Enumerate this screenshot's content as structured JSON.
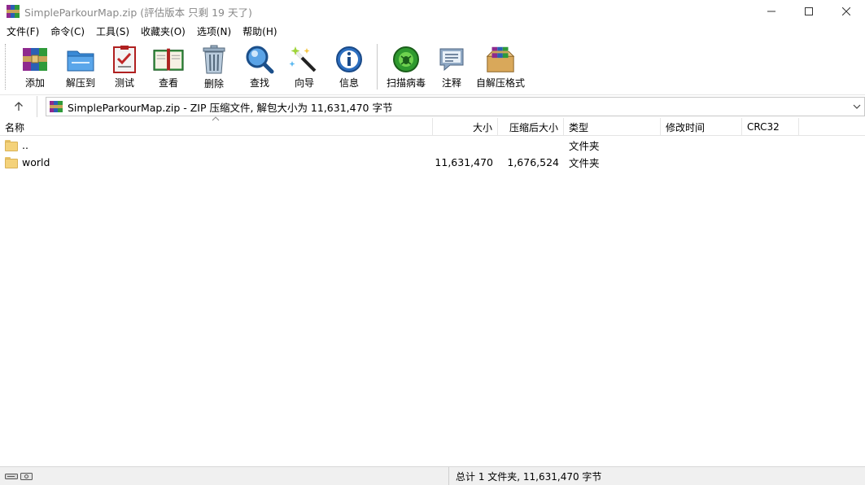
{
  "window": {
    "title": "SimpleParkourMap.zip (評估版本 只剩 19 天了)"
  },
  "menu": [
    {
      "label": "文件(F)"
    },
    {
      "label": "命令(C)"
    },
    {
      "label": "工具(S)"
    },
    {
      "label": "收藏夹(O)"
    },
    {
      "label": "选项(N)"
    },
    {
      "label": "帮助(H)"
    }
  ],
  "toolbar": [
    {
      "label": "添加",
      "icon": "add-archive-icon"
    },
    {
      "label": "解压到",
      "icon": "extract-to-icon"
    },
    {
      "label": "测试",
      "icon": "test-icon"
    },
    {
      "label": "查看",
      "icon": "view-icon"
    },
    {
      "label": "删除",
      "icon": "delete-icon"
    },
    {
      "label": "查找",
      "icon": "find-icon"
    },
    {
      "label": "向导",
      "icon": "wizard-icon"
    },
    {
      "label": "信息",
      "icon": "info-icon"
    },
    {
      "label": "扫描病毒",
      "icon": "virus-scan-icon"
    },
    {
      "label": "注释",
      "icon": "comment-icon"
    },
    {
      "label": "自解压格式",
      "icon": "sfx-icon"
    }
  ],
  "address": {
    "path": "SimpleParkourMap.zip - ZIP 压缩文件, 解包大小为 11,631,470 字节"
  },
  "columns": {
    "name": "名称",
    "size": "大小",
    "packed": "压缩后大小",
    "type": "类型",
    "modified": "修改时间",
    "crc": "CRC32"
  },
  "rows": [
    {
      "name": "..",
      "size": "",
      "packed": "",
      "type": "文件夹",
      "modified": "",
      "crc": ""
    },
    {
      "name": "world",
      "size": "11,631,470",
      "packed": "1,676,524",
      "type": "文件夹",
      "modified": "",
      "crc": ""
    }
  ],
  "status": {
    "summary": "总计 1 文件夹, 11,631,470 字节"
  }
}
